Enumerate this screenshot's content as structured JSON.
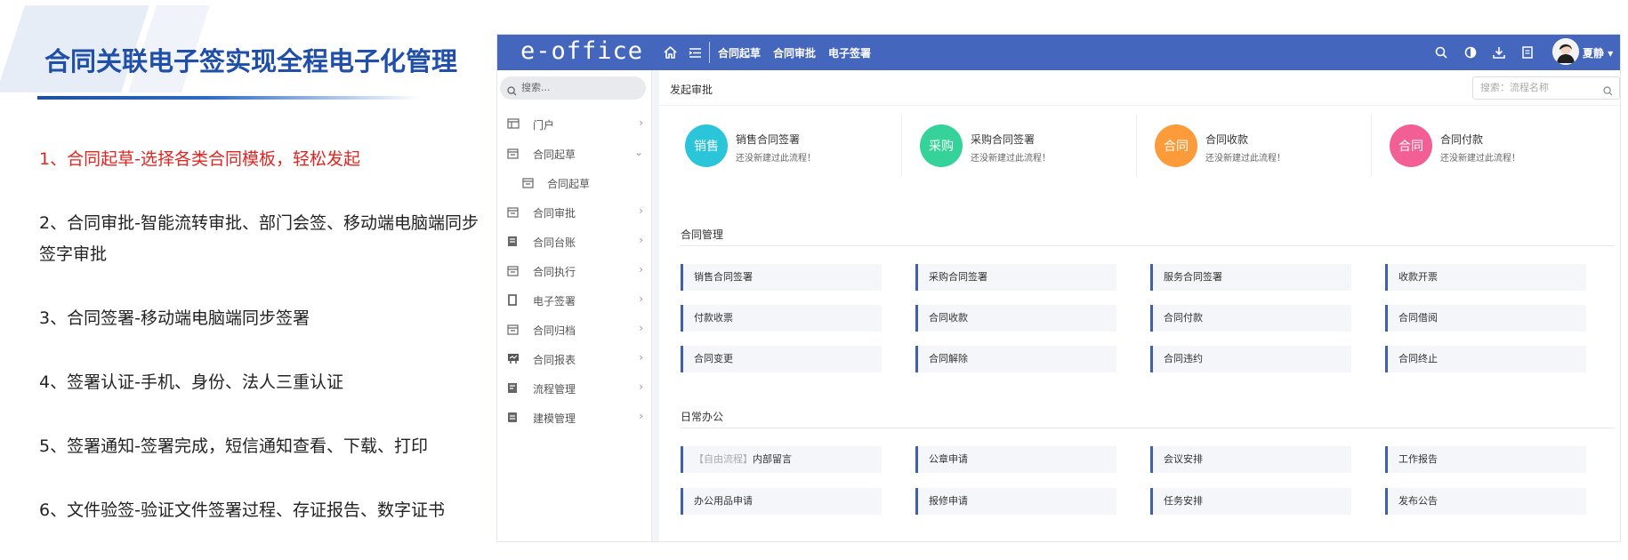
{
  "slide": {
    "title": "合同关联电子签实现全程电子化管理",
    "points": [
      "1、合同起草-选择各类合同模板，轻松发起",
      "2、合同审批-智能流转审批、部门会签、移动端电脑端同步签字审批",
      "3、合同签署-移动端电脑端同步签署",
      "4、签署认证-手机、身份、法人三重认证",
      "5、签署通知-签署完成，短信通知查看、下载、打印",
      "6、文件验签-验证文件签署过程、存证报告、数字证书"
    ]
  },
  "app": {
    "logo": "e-office",
    "nav_links": [
      "合同起草",
      "合同审批",
      "电子签署"
    ],
    "user_name": "夏静",
    "accent_color": "#4466bd",
    "sidebar": {
      "search_placeholder": "搜索...",
      "items": [
        {
          "label": "门户",
          "icon": "portal-icon"
        },
        {
          "label": "合同起草",
          "icon": "folder-icon",
          "expanded": true
        },
        {
          "label": "合同起草",
          "icon": "folder-icon",
          "sub": true
        },
        {
          "label": "合同审批",
          "icon": "folder-icon"
        },
        {
          "label": "合同台账",
          "icon": "ledger-icon"
        },
        {
          "label": "合同执行",
          "icon": "folder-icon"
        },
        {
          "label": "电子签署",
          "icon": "sign-icon"
        },
        {
          "label": "合同归档",
          "icon": "folder-icon"
        },
        {
          "label": "合同报表",
          "icon": "report-icon"
        },
        {
          "label": "流程管理",
          "icon": "flow-icon"
        },
        {
          "label": "建模管理",
          "icon": "model-icon"
        }
      ]
    },
    "content": {
      "title": "发起审批",
      "flow_search_placeholder": "搜索：流程名称",
      "quick_cards": [
        {
          "badge": "销售",
          "title": "销售合同签署",
          "subtitle": "还没新建过此流程！",
          "color": "#2bc5da"
        },
        {
          "badge": "采购",
          "title": "采购合同签署",
          "subtitle": "还没新建过此流程！",
          "color": "#35d39a"
        },
        {
          "badge": "合同",
          "title": "合同收款",
          "subtitle": "还没新建过此流程！",
          "color": "#fb9b39"
        },
        {
          "badge": "合同",
          "title": "合同付款",
          "subtitle": "还没新建过此流程！",
          "color": "#f15f94"
        }
      ],
      "sections": [
        {
          "title": "合同管理",
          "tiles": [
            "销售合同签署",
            "采购合同签署",
            "服务合同签署",
            "收款开票",
            "付款收票",
            "合同收款",
            "合同付款",
            "合同借阅",
            "合同变更",
            "合同解除",
            "合同违约",
            "合同终止"
          ]
        },
        {
          "title": "日常办公",
          "tiles": [
            "内部留言",
            "公章申请",
            "会议安排",
            "工作报告",
            "办公用品申请",
            "报修申请",
            "任务安排",
            "发布公告"
          ],
          "first_tile_tag": "【自由流程】"
        }
      ]
    }
  }
}
